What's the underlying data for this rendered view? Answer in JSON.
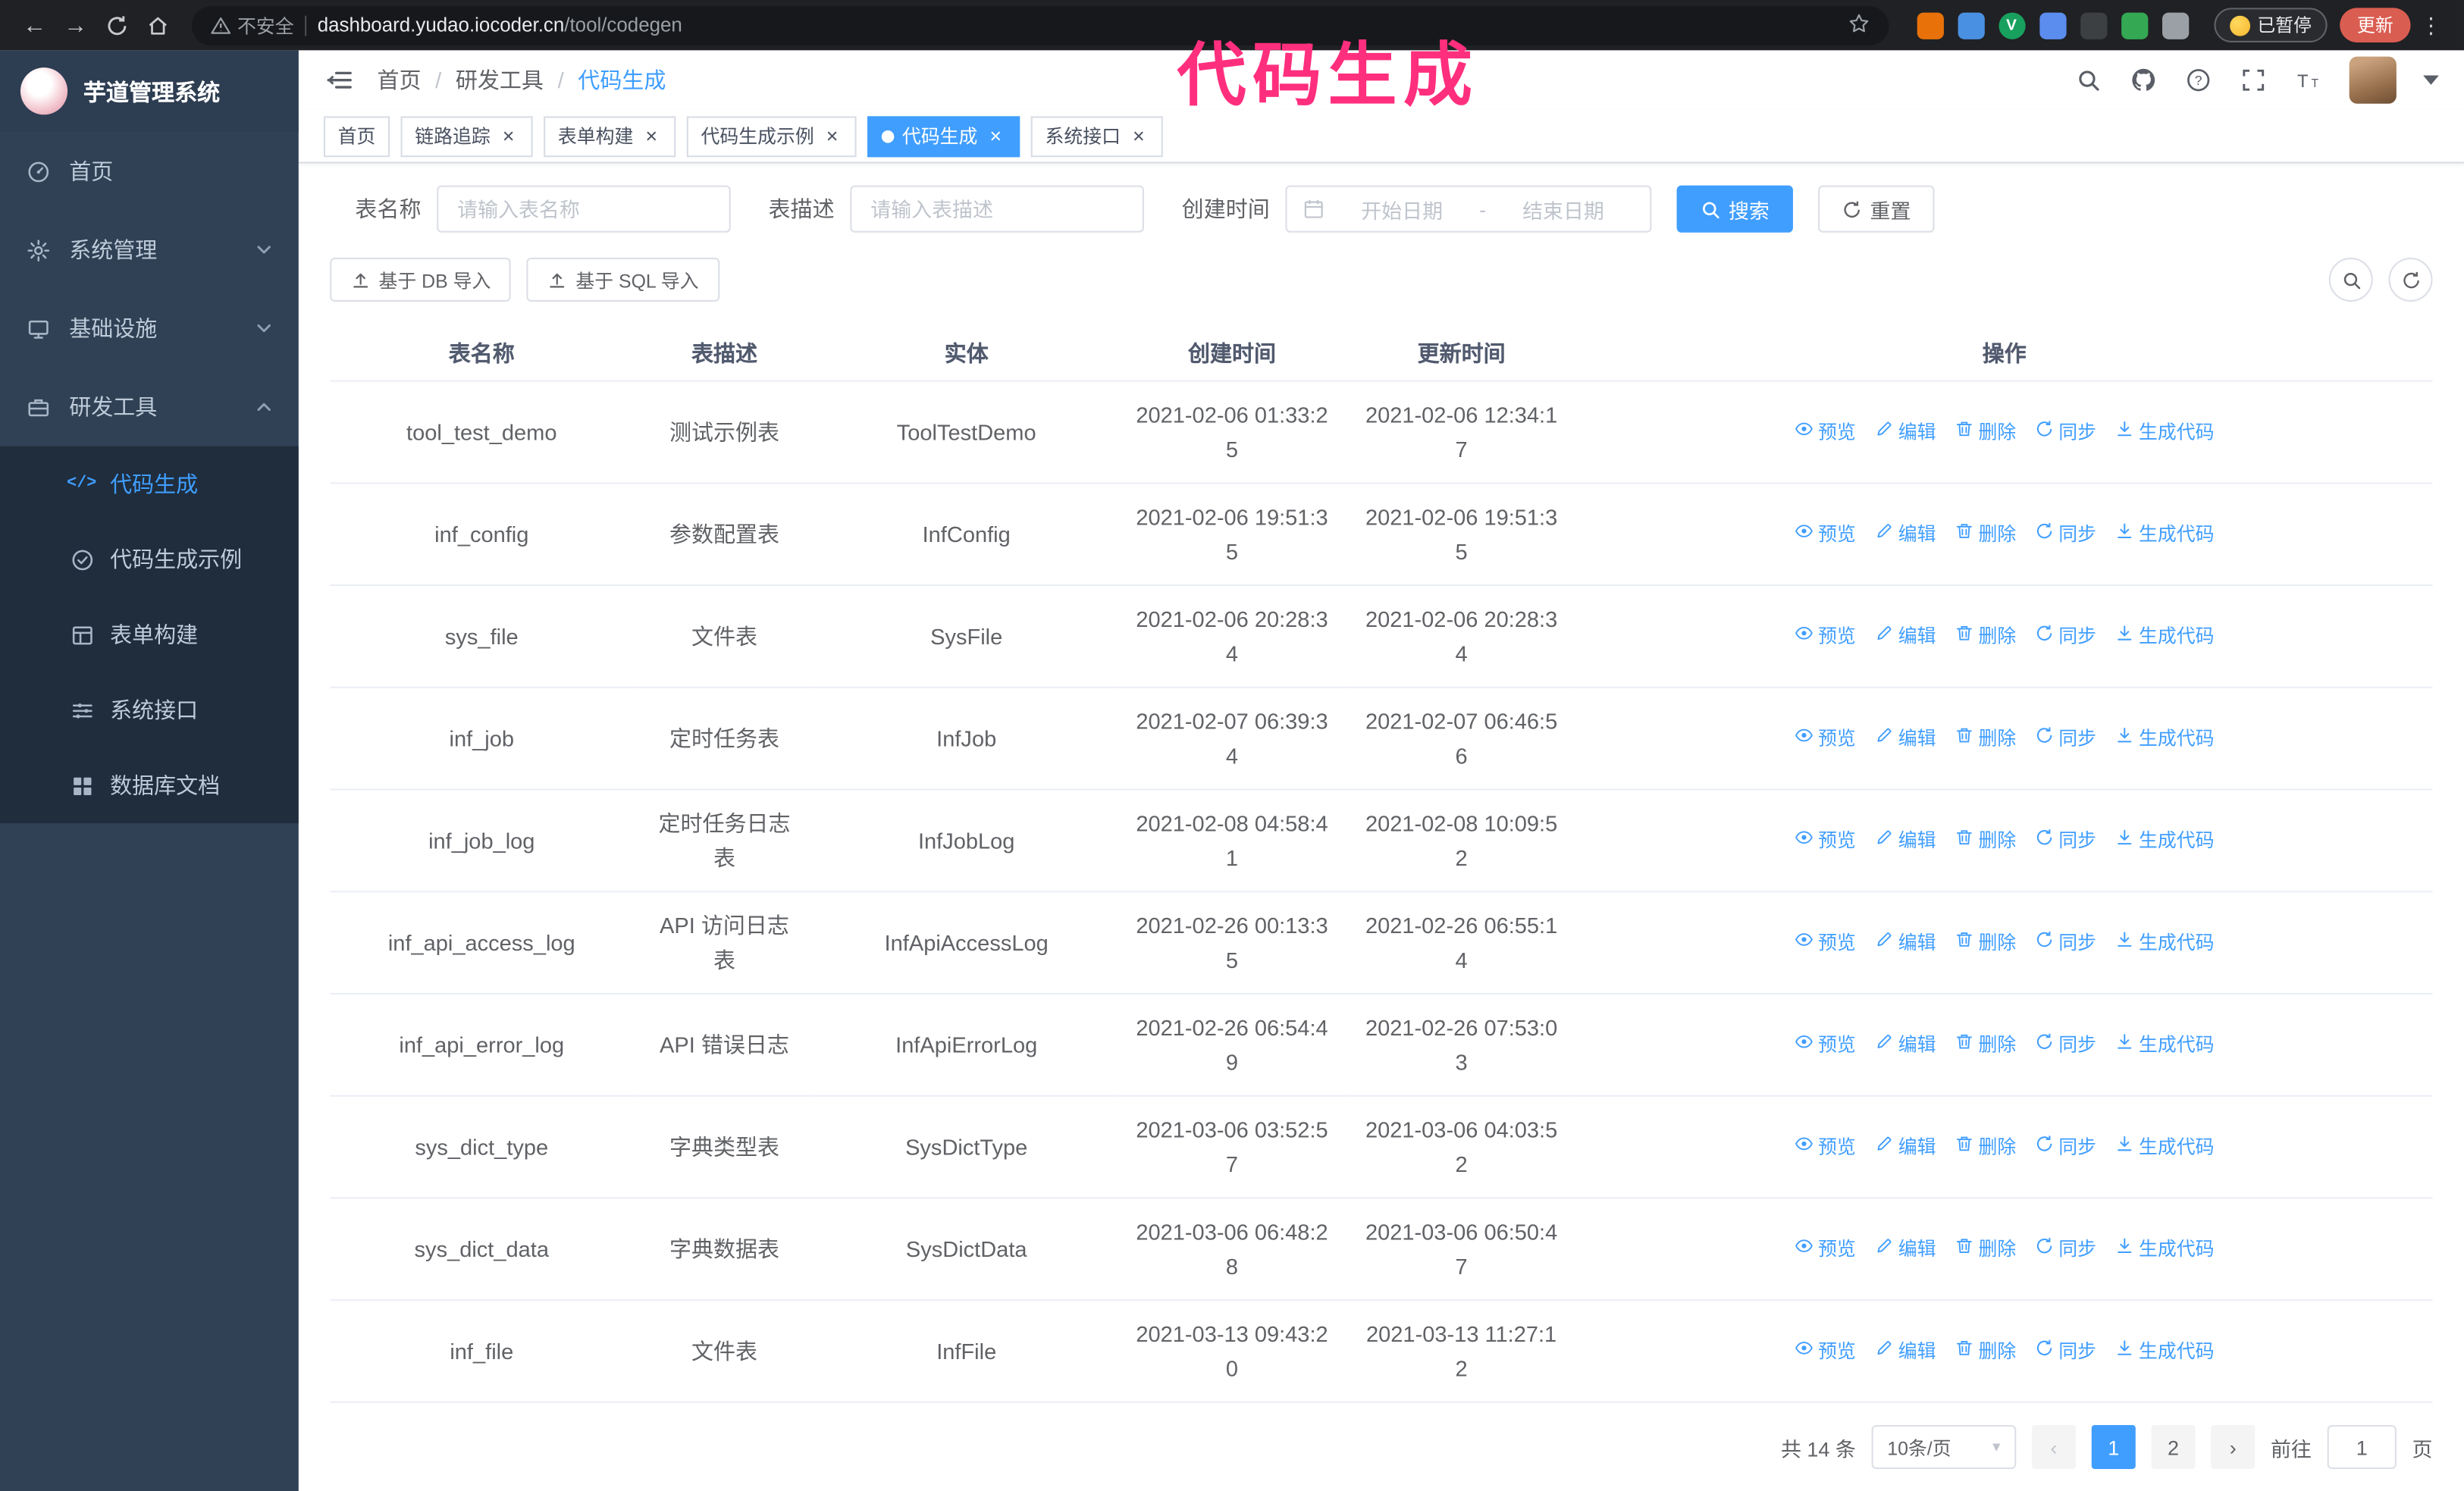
{
  "annotation": {
    "text": "代码生成"
  },
  "colors": {
    "primary": "#409eff",
    "annotation_pink": "#ff2f7e",
    "sidebar_bg": "#304156",
    "submenu_bg": "#1f2d3d",
    "tab_active_bg": "#409eff",
    "update_button_bg": "#da5d51"
  },
  "browser": {
    "security_label": "不安全",
    "url_host": "dashboard.yudao.iocoder.cn",
    "url_path": "/tool/codegen",
    "paused_badge": "已暂停",
    "update_button": "更新",
    "extensions": [
      {
        "name": "orange-extension",
        "color": "#e8710a",
        "letter": ""
      },
      {
        "name": "blue-drop-extension",
        "color": "#4a90e2",
        "letter": ""
      },
      {
        "name": "green-v-extension",
        "color": "#18a05e",
        "letter": "V"
      },
      {
        "name": "people-extension",
        "color": "#5b8def",
        "letter": ""
      },
      {
        "name": "dark-extension",
        "color": "#3c4043",
        "letter": ""
      },
      {
        "name": "leaf-extension",
        "color": "#34a853",
        "letter": ""
      },
      {
        "name": "puzzle-extension",
        "color": "#9aa0a6",
        "letter": ""
      }
    ]
  },
  "sidebar": {
    "app_title": "芋道管理系统",
    "menu": [
      {
        "key": "home",
        "label": "首页",
        "icon": "dashboard-icon"
      },
      {
        "key": "system",
        "label": "系统管理",
        "icon": "gear-icon",
        "chevron": "down"
      },
      {
        "key": "infra",
        "label": "基础设施",
        "icon": "infra-icon",
        "chevron": "down"
      },
      {
        "key": "devtools",
        "label": "研发工具",
        "icon": "toolbox-icon",
        "chevron": "up",
        "expanded": true,
        "children": [
          {
            "key": "codegen",
            "label": "代码生成",
            "icon": "code-icon",
            "active": true
          },
          {
            "key": "codegen-example",
            "label": "代码生成示例",
            "icon": "check-circle-icon"
          },
          {
            "key": "form-build",
            "label": "表单构建",
            "icon": "form-icon"
          },
          {
            "key": "api",
            "label": "系统接口",
            "icon": "api-icon"
          },
          {
            "key": "db-doc",
            "label": "数据库文档",
            "icon": "grid-icon"
          }
        ]
      }
    ]
  },
  "header": {
    "breadcrumb": [
      "首页",
      "研发工具",
      "代码生成"
    ]
  },
  "tabs": [
    {
      "key": "home",
      "label": "首页",
      "closable": false,
      "active": false
    },
    {
      "key": "trace",
      "label": "链路追踪",
      "closable": true,
      "active": false
    },
    {
      "key": "form-build",
      "label": "表单构建",
      "closable": true,
      "active": false
    },
    {
      "key": "codegen-example",
      "label": "代码生成示例",
      "closable": true,
      "active": false
    },
    {
      "key": "codegen",
      "label": "代码生成",
      "closable": true,
      "active": true
    },
    {
      "key": "api",
      "label": "系统接口",
      "closable": true,
      "active": false
    }
  ],
  "filters": {
    "table_name_label": "表名称",
    "table_name_placeholder": "请输入表名称",
    "table_desc_label": "表描述",
    "table_desc_placeholder": "请输入表描述",
    "create_time_label": "创建时间",
    "date_start_placeholder": "开始日期",
    "date_separator": "-",
    "date_end_placeholder": "结束日期",
    "search_button": "搜索",
    "reset_button": "重置"
  },
  "toolbar": {
    "import_db_button": "基于 DB 导入",
    "import_sql_button": "基于 SQL 导入"
  },
  "table": {
    "columns": [
      "表名称",
      "表描述",
      "实体",
      "创建时间",
      "更新时间",
      "操作"
    ],
    "actions": [
      {
        "label": "预览",
        "icon": "eye-icon"
      },
      {
        "label": "编辑",
        "icon": "edit-icon"
      },
      {
        "label": "删除",
        "icon": "delete-icon"
      },
      {
        "label": "同步",
        "icon": "sync-icon"
      },
      {
        "label": "生成代码",
        "icon": "download-icon"
      }
    ],
    "rows": [
      {
        "name": "tool_test_demo",
        "desc": "测试示例表",
        "entity": "ToolTestDemo",
        "created": "2021-02-06 01:33:25",
        "updated": "2021-02-06 12:34:17"
      },
      {
        "name": "inf_config",
        "desc": "参数配置表",
        "entity": "InfConfig",
        "created": "2021-02-06 19:51:35",
        "updated": "2021-02-06 19:51:35"
      },
      {
        "name": "sys_file",
        "desc": "文件表",
        "entity": "SysFile",
        "created": "2021-02-06 20:28:34",
        "updated": "2021-02-06 20:28:34"
      },
      {
        "name": "inf_job",
        "desc": "定时任务表",
        "entity": "InfJob",
        "created": "2021-02-07 06:39:34",
        "updated": "2021-02-07 06:46:56"
      },
      {
        "name": "inf_job_log",
        "desc": "定时任务日志表",
        "entity": "InfJobLog",
        "created": "2021-02-08 04:58:41",
        "updated": "2021-02-08 10:09:52"
      },
      {
        "name": "inf_api_access_log",
        "desc": "API 访问日志表",
        "entity": "InfApiAccessLog",
        "created": "2021-02-26 00:13:35",
        "updated": "2021-02-26 06:55:14"
      },
      {
        "name": "inf_api_error_log",
        "desc": "API 错误日志",
        "entity": "InfApiErrorLog",
        "created": "2021-02-26 06:54:49",
        "updated": "2021-02-26 07:53:03"
      },
      {
        "name": "sys_dict_type",
        "desc": "字典类型表",
        "entity": "SysDictType",
        "created": "2021-03-06 03:52:57",
        "updated": "2021-03-06 04:03:52"
      },
      {
        "name": "sys_dict_data",
        "desc": "字典数据表",
        "entity": "SysDictData",
        "created": "2021-03-06 06:48:28",
        "updated": "2021-03-06 06:50:47"
      },
      {
        "name": "inf_file",
        "desc": "文件表",
        "entity": "InfFile",
        "created": "2021-03-13 09:43:20",
        "updated": "2021-03-13 11:27:12"
      }
    ]
  },
  "pagination": {
    "total_text": "共 14 条",
    "page_size": "10条/页",
    "pages": [
      "1",
      "2"
    ],
    "active_page": "1",
    "goto_label": "前往",
    "goto_value": "1",
    "goto_suffix": "页"
  }
}
